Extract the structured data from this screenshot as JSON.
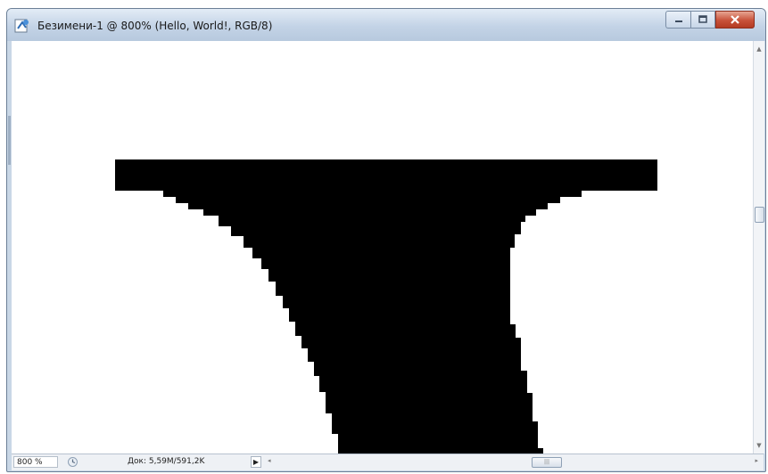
{
  "window": {
    "title": "Безимени-1 @ 800% (Hello, World!, RGB/8)",
    "buttons": {
      "minimize": "minimize",
      "maximize": "maximize",
      "close": "close"
    },
    "app_icon": "photoshop-document-icon"
  },
  "status": {
    "zoom": "800 %",
    "doc_info": "Док: 5,59M/591,2K",
    "info_icon": "status-info-icon",
    "menu_arrow": "▶"
  },
  "scrollbars": {
    "vertical_up": "▲",
    "vertical_down": "▼",
    "horizontal_left": "◂",
    "horizontal_right": "▸",
    "thumb_grip": "|||"
  },
  "colors": {
    "canvas": "#ffffff",
    "glyph": "#000000",
    "chrome": "#c9d7e6",
    "close_button": "#c8523a"
  }
}
